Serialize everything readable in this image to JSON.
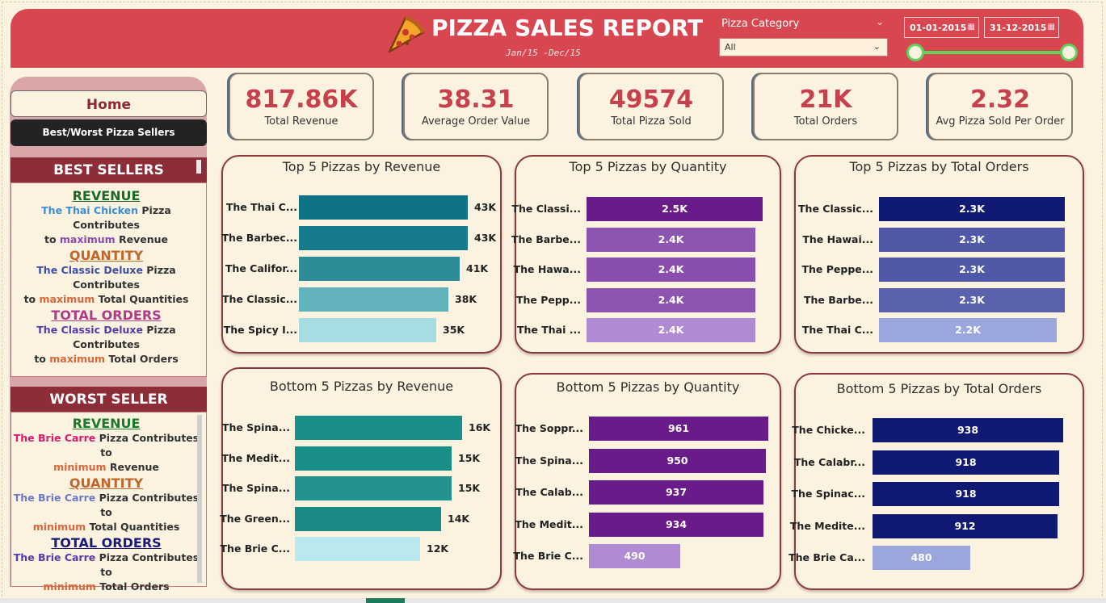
{
  "header": {
    "title": "PIZZA SALES REPORT",
    "subtitle": "Jan/15 -Dec/15",
    "slicer_label": "Pizza Category",
    "slicer_value": "All",
    "date_start": "01-01-2015",
    "date_end": "31-12-2015"
  },
  "nav": {
    "home_label": "Home",
    "best_worst_label": "Best/Worst Pizza Sellers"
  },
  "best": {
    "heading": "BEST SELLERS",
    "revenue": {
      "title": "REVENUE",
      "name": "The Thai Chicken",
      "mid": " Pizza Contributes",
      "pre2": "to ",
      "key": "maximum",
      "post": "  Revenue"
    },
    "quantity": {
      "title": "QUANTITY",
      "name": "The Classic Deluxe",
      "mid": " Pizza Contributes",
      "pre2": "to ",
      "key": "maximum",
      "post": " Total Quantities"
    },
    "orders": {
      "title": "TOTAL ORDERS",
      "name": "The Classic Deluxe",
      "mid": " Pizza Contributes",
      "pre2": "to ",
      "key": "maximum",
      "post": " Total Orders"
    }
  },
  "worst": {
    "heading": "WORST SELLER",
    "revenue": {
      "title": "REVENUE",
      "name": "The Brie Carre",
      "mid": " Pizza Contributes to",
      "key": "minimum",
      "post": "  Revenue"
    },
    "quantity": {
      "title": "QUANTITY",
      "name": "The Brie Carre",
      "mid": " Pizza Contributes to",
      "key": "minimum",
      "post": " Total Quantities"
    },
    "orders": {
      "title": "TOTAL ORDERS",
      "name": "The Brie Carre",
      "mid": " Pizza Contributes to",
      "key": "minimum",
      "post": " Total Orders"
    }
  },
  "kpis": [
    {
      "value": "817.86K",
      "label": "Total Revenue"
    },
    {
      "value": "38.31",
      "label": "Average Order Value"
    },
    {
      "value": "49574",
      "label": "Total Pizza Sold"
    },
    {
      "value": "21K",
      "label": "Total Orders"
    },
    {
      "value": "2.32",
      "label": "Avg Pizza Sold Per Order"
    }
  ],
  "colors": {
    "header": "#d84650",
    "accent_red": "#c7404c",
    "section_head": "#8c2d37"
  },
  "chart_data": [
    {
      "type": "bar",
      "title": "Top 5 Pizzas by Revenue",
      "categories": [
        "The Thai C...",
        "The Barbec...",
        "The Califor...",
        "The Classic...",
        "The Spicy I..."
      ],
      "values": [
        43,
        43,
        41,
        38,
        35
      ],
      "labels": [
        "43K",
        "43K",
        "41K",
        "38K",
        "35K"
      ],
      "colors": [
        "#0e7485",
        "#167c8b",
        "#2e8c99",
        "#62b2bd",
        "#a5dde3"
      ],
      "label_position": "outside"
    },
    {
      "type": "bar",
      "title": "Top 5 Pizzas by Quantity",
      "categories": [
        "The Classi...",
        "The Barbe...",
        "The Hawa...",
        "The Pepp...",
        "The Thai ..."
      ],
      "values": [
        2.5,
        2.4,
        2.4,
        2.4,
        2.4
      ],
      "labels": [
        "2.5K",
        "2.4K",
        "2.4K",
        "2.4K",
        "2.4K"
      ],
      "colors": [
        "#6a1b8a",
        "#8e55b0",
        "#8a4fae",
        "#8e55b0",
        "#b08ad2"
      ],
      "label_position": "inside"
    },
    {
      "type": "bar",
      "title": "Top 5 Pizzas by Total Orders",
      "categories": [
        "The Classic...",
        "The Hawai...",
        "The Peppe...",
        "The Barbe...",
        "The Thai C..."
      ],
      "values": [
        2.3,
        2.3,
        2.3,
        2.3,
        2.2
      ],
      "labels": [
        "2.3K",
        "2.3K",
        "2.3K",
        "2.3K",
        "2.2K"
      ],
      "colors": [
        "#111a72",
        "#5058a8",
        "#5058a8",
        "#5a62ae",
        "#9aa6dc"
      ],
      "label_position": "inside"
    },
    {
      "type": "bar",
      "title": "Bottom 5 Pizzas by Revenue",
      "categories": [
        "The Spina...",
        "The Medit...",
        "The Spina...",
        "The Green...",
        "The Brie C..."
      ],
      "values": [
        16,
        15,
        15,
        14,
        12
      ],
      "labels": [
        "16K",
        "15K",
        "15K",
        "14K",
        "12K"
      ],
      "colors": [
        "#1a8f8a",
        "#1a8f8a",
        "#229390",
        "#1a8a86",
        "#b9e8ee"
      ],
      "label_position": "outside"
    },
    {
      "type": "bar",
      "title": "Bottom 5 Pizzas by Quantity",
      "categories": [
        "The Soppr...",
        "The Spina...",
        "The Calab...",
        "The Medit...",
        "The Brie C..."
      ],
      "values": [
        961,
        950,
        937,
        934,
        490
      ],
      "labels": [
        "961",
        "950",
        "937",
        "934",
        "490"
      ],
      "colors": [
        "#6a1b8a",
        "#6a1b8a",
        "#6a1b8a",
        "#6a1b8a",
        "#b08ad2"
      ],
      "label_position": "inside"
    },
    {
      "type": "bar",
      "title": "Bottom 5 Pizzas by Total Orders",
      "categories": [
        "The Chicke...",
        "The Calabr...",
        "The Spinac...",
        "The Medite...",
        "The Brie Ca..."
      ],
      "values": [
        938,
        918,
        918,
        912,
        480
      ],
      "labels": [
        "938",
        "918",
        "918",
        "912",
        "480"
      ],
      "colors": [
        "#111a72",
        "#111a72",
        "#111a72",
        "#111a72",
        "#9aa6dc"
      ],
      "label_position": "inside"
    }
  ]
}
